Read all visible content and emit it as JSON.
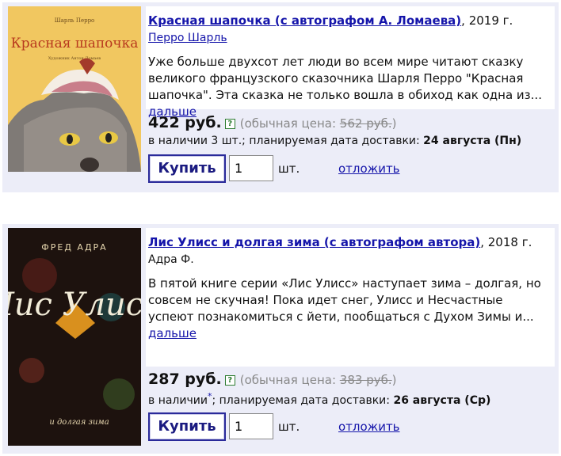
{
  "items": [
    {
      "title": "Красная шапочка (с автографом А. Ломаева)",
      "year": ", 2019 г.",
      "author": "Перро Шарль",
      "description": "Уже больше двухсот лет люди во всем мире читают сказку великого французского сказочника Шарля Перро \"Красная шапочка\". Эта сказка не только вошла в обиход как одна из...",
      "more": "дальше",
      "price": "422 руб.",
      "info_icon": "?",
      "regular_label": "(обычная цена: ",
      "regular_price": "562 руб.",
      "regular_close": ")",
      "availability": "в наличии 3 шт.; планируемая дата доставки: ",
      "delivery_date": "24 августа (Пн)",
      "buy_label": "Купить",
      "quantity": "1",
      "unit": "шт.",
      "later_label": "отложить",
      "cover": {
        "author": "Шарль Перро",
        "title": "Красная шапочка",
        "illustrator": "Художник Антон Ломаев",
        "background": "#f1c760"
      }
    },
    {
      "title": "Лис Улисс и долгая зима (с автографом автора)",
      "year": ", 2018 г.",
      "author": "Адра Ф.",
      "description": "В пятой книге серии «Лис Улисс» наступает зима – долгая, но совсем не скучная! Пока идет снег, Улисс и Несчастные успеют познакомиться с йети, пообщаться с Духом Зимы и...",
      "more": "дальше",
      "price": "287 руб.",
      "info_icon": "?",
      "regular_label": "(обычная цена: ",
      "regular_price": "383 руб.",
      "regular_close": ")",
      "availability_prefix": "в наличии",
      "availability_star": "*",
      "availability": "; планируемая дата доставки: ",
      "delivery_date": "26 августа (Ср)",
      "buy_label": "Купить",
      "quantity": "1",
      "unit": "шт.",
      "later_label": "отложить",
      "cover": {
        "author": "ФРЕД АДРА",
        "title": "Лис Улисс",
        "subtitle": "и долгая зима",
        "background": "#1d120e"
      }
    }
  ],
  "colors": {
    "card_bg": "#ecedf8",
    "link": "#1515aa",
    "button_border": "#2a2a9a"
  }
}
